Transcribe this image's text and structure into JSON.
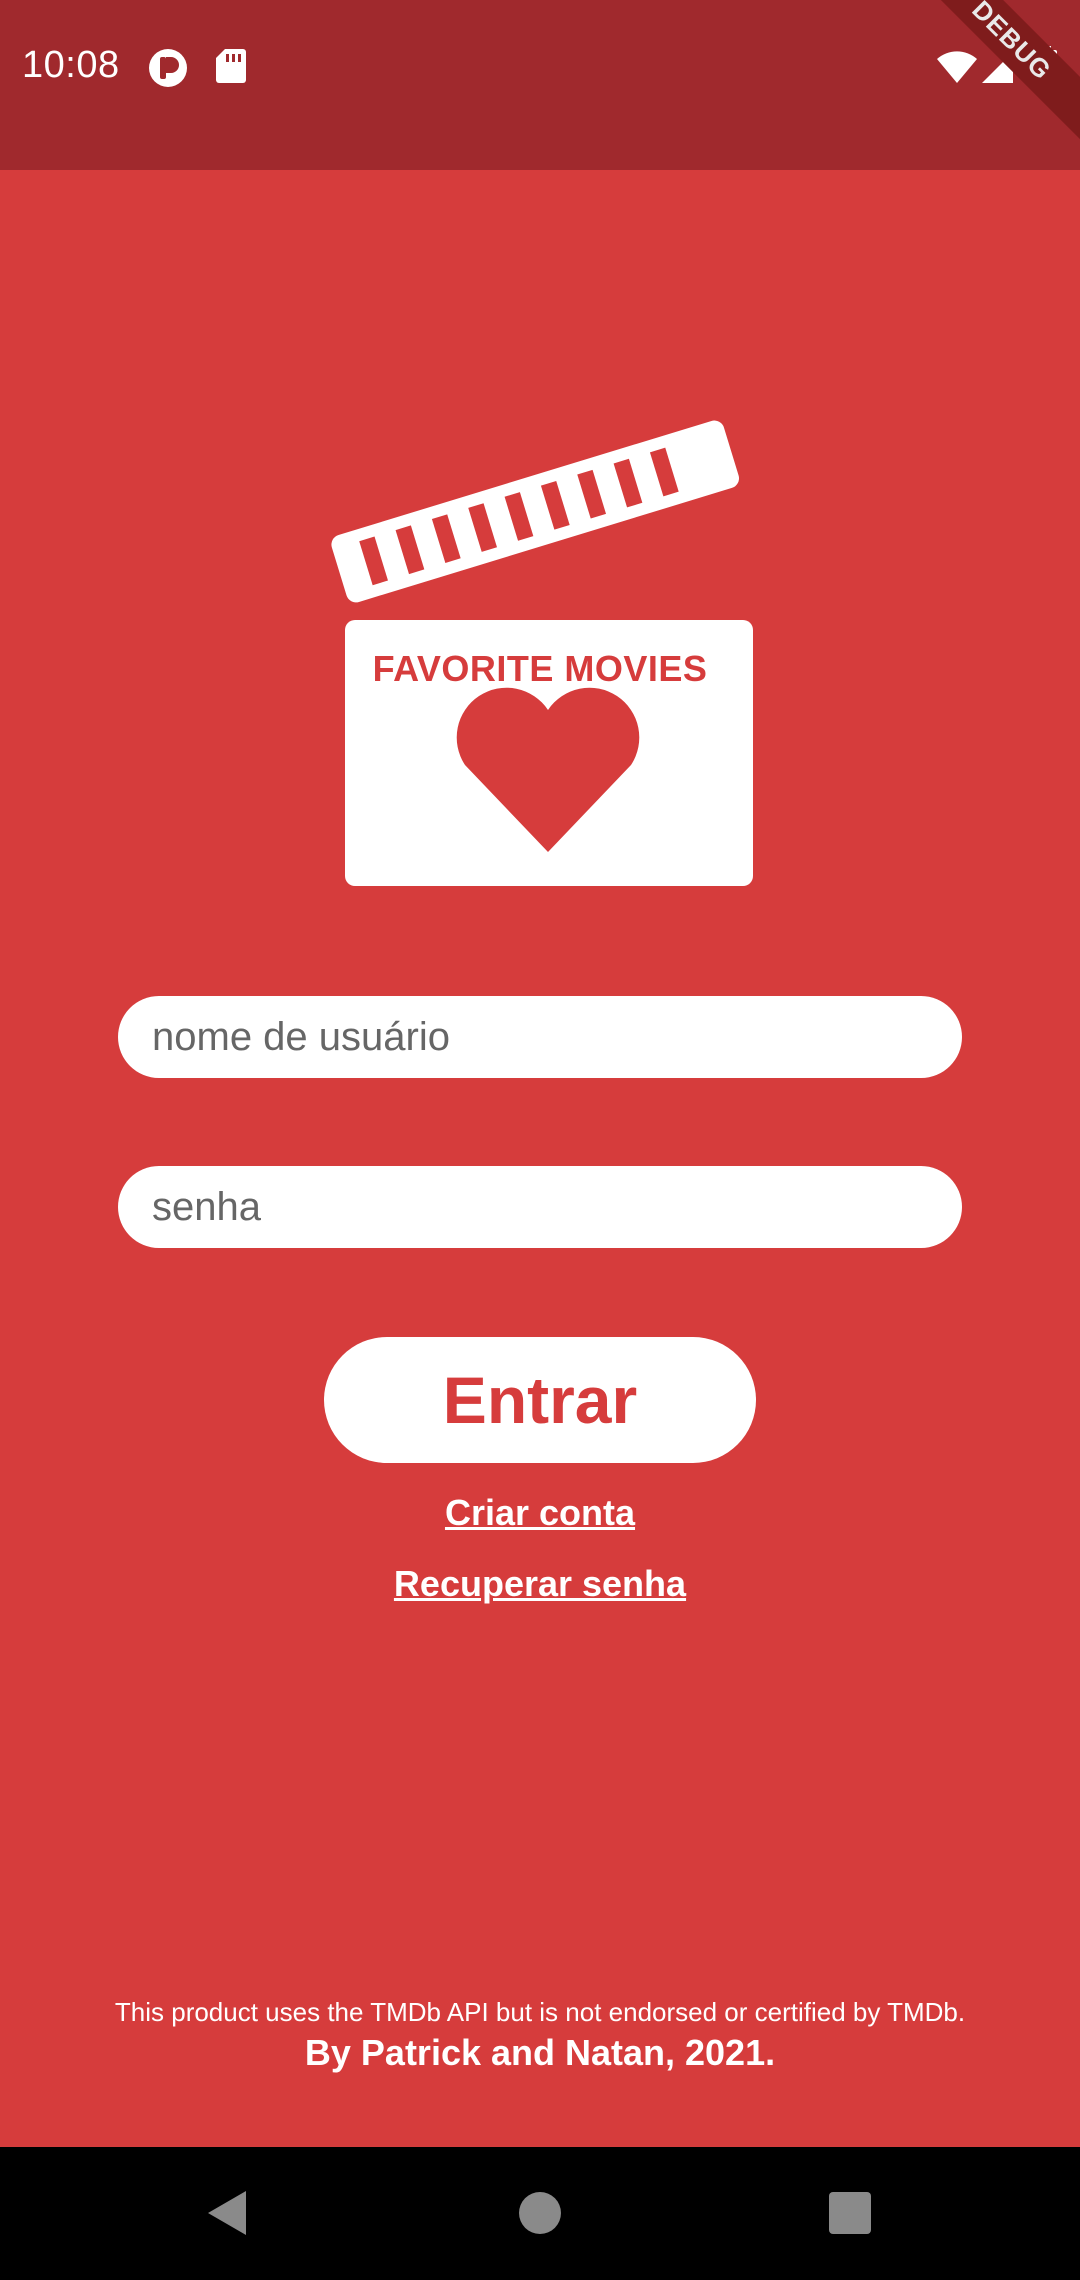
{
  "status_bar": {
    "time": "10:08",
    "debug_label": "DEBUG",
    "icons": [
      "record-icon",
      "sd-card-icon",
      "wifi-icon",
      "signal-icon",
      "battery-icon"
    ]
  },
  "logo": {
    "title": "FAVORITE MOVIES",
    "icon": "clapperboard-heart-icon"
  },
  "form": {
    "username_placeholder": "nome de usuário",
    "password_placeholder": "senha",
    "login_label": "Entrar",
    "create_account_label": "Criar conta",
    "recover_password_label": "Recuperar senha"
  },
  "footer": {
    "disclaimer": "This product uses the TMDb API but is not endorsed or certified by TMDb.",
    "credits": "By Patrick and Natan, 2021."
  },
  "nav": {
    "icons": [
      "back-icon",
      "home-icon",
      "recents-icon"
    ]
  },
  "colors": {
    "background": "#d63c3c",
    "status_bar": "#a0292d",
    "surface": "#ffffff",
    "nav_bar": "#000000"
  }
}
